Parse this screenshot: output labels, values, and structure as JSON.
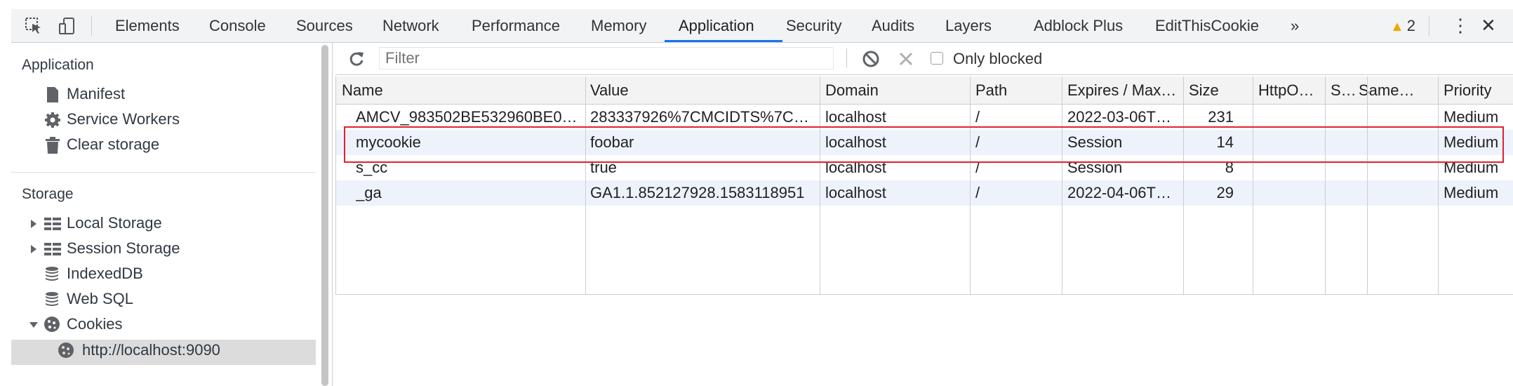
{
  "tabbar": {
    "tabs": [
      "Elements",
      "Console",
      "Sources",
      "Network",
      "Performance",
      "Memory",
      "Application",
      "Security",
      "Audits",
      "Layers",
      "Adblock Plus",
      "EditThisCookie"
    ],
    "more": "»",
    "warning_count": "2",
    "menu": "⋮",
    "close": "✕"
  },
  "sidebar": {
    "application_header": "Application",
    "application_items": [
      "Manifest",
      "Service Workers",
      "Clear storage"
    ],
    "storage_header": "Storage",
    "storage_items": [
      "Local Storage",
      "Session Storage",
      "IndexedDB",
      "Web SQL",
      "Cookies"
    ],
    "cookie_origin": "http://localhost:9090"
  },
  "toolbar": {
    "filter_placeholder": "Filter",
    "only_blocked": "Only blocked"
  },
  "table": {
    "columns": [
      "Name",
      "Value",
      "Domain",
      "Path",
      "Expires / Max…",
      "Size",
      "HttpO…",
      "S…",
      "Same…",
      "Priority"
    ],
    "rows": [
      [
        "AMCV_983502BE532960BE0…",
        "283337926%7CMCIDTS%7C…",
        "localhost",
        "/",
        "2022-03-06T…",
        "231",
        "",
        "",
        "",
        "Medium"
      ],
      [
        "mycookie",
        "foobar",
        "localhost",
        "/",
        "Session",
        "14",
        "",
        "",
        "",
        "Medium"
      ],
      [
        "s_cc",
        "true",
        "localhost",
        "/",
        "Session",
        "8",
        "",
        "",
        "",
        "Medium"
      ],
      [
        "_ga",
        "GA1.1.852127928.1583118951",
        "localhost",
        "/",
        "2022-04-06T…",
        "29",
        "",
        "",
        "",
        "Medium"
      ]
    ]
  },
  "colors": {
    "accent": "#1a73e8",
    "highlight_border": "#e0232e",
    "warning": "#f2a600"
  }
}
